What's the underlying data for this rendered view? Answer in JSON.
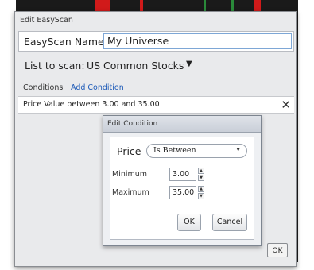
{
  "dialog": {
    "title": "Edit EasyScan",
    "name_label": "EasyScan Name",
    "name_value": "My Universe",
    "list_label": "List to scan:",
    "list_value": "US Common Stocks",
    "list_caret": "▼",
    "conditions_label": "Conditions",
    "add_condition_label": "Add Condition",
    "conditions": [
      {
        "text": "Price Value between 3.00 and 35.00",
        "remove_glyph": "✕"
      }
    ],
    "ok_label": "OK"
  },
  "edit_condition": {
    "title": "Edit Condition",
    "field_label": "Price",
    "operator_value": "Is Between",
    "operator_caret": "▼",
    "minimum_label": "Minimum",
    "minimum_value": "3.00",
    "maximum_label": "Maximum",
    "maximum_value": "35.00",
    "spin_up_glyph": "▲",
    "spin_down_glyph": "▼",
    "ok_label": "OK",
    "cancel_label": "Cancel"
  },
  "colors": {
    "background_chart": "#1a1a1a",
    "dialog_bg": "#e9eaec",
    "link": "#1e5bb8",
    "accent_red": "#d11a1a",
    "accent_green": "#2a8a3a"
  }
}
